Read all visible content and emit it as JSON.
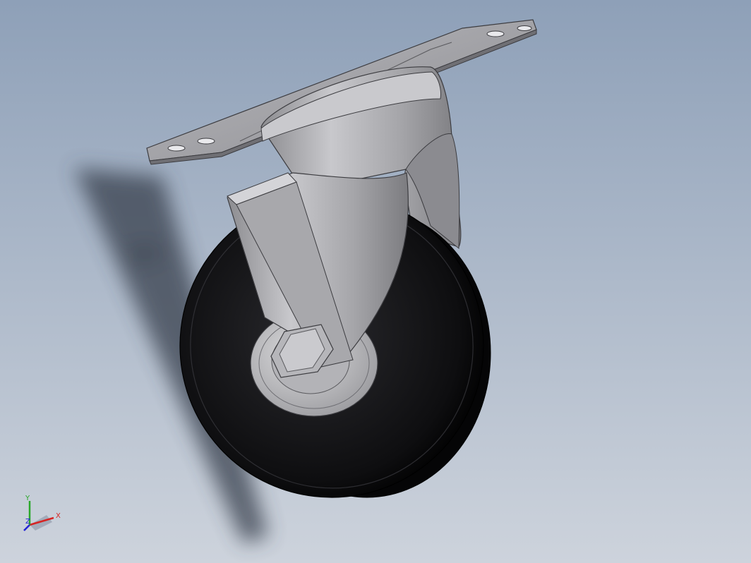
{
  "viewport": {
    "background_top": "#8ea0b8",
    "background_bottom": "#cdd3dc"
  },
  "model": {
    "part": "caster-wheel",
    "icon": "caster-wheel-icon",
    "colors": {
      "metal": "#a9a9ad",
      "metal_shadow": "#7f7f84",
      "wheel": "#0e0e10",
      "hub": "#bdbdbf",
      "shadow": "#3a4350"
    }
  },
  "triad": {
    "x_label": "X",
    "y_label": "Y",
    "z_label": "Z",
    "x_color": "#d62424",
    "y_color": "#2aa82a",
    "z_color": "#2424d6"
  }
}
